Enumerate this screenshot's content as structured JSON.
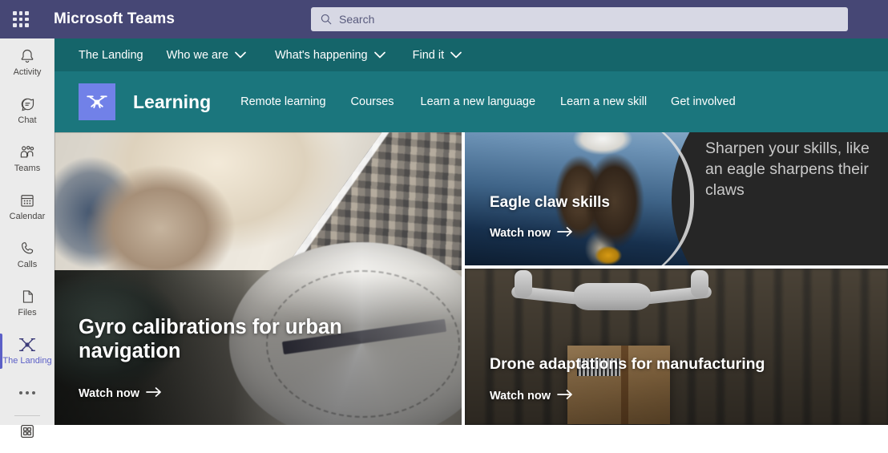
{
  "top_bar": {
    "app_title": "Microsoft Teams",
    "waffle_icon": "grid-apps-icon",
    "search": {
      "icon": "search-icon",
      "placeholder": "Search",
      "value": ""
    }
  },
  "left_rail": {
    "items": [
      {
        "label": "Activity",
        "icon": "bell-icon",
        "active": false
      },
      {
        "label": "Chat",
        "icon": "chat-icon",
        "active": false
      },
      {
        "label": "Teams",
        "icon": "people-icon",
        "active": false
      },
      {
        "label": "Calendar",
        "icon": "calendar-icon",
        "active": false
      },
      {
        "label": "Calls",
        "icon": "phone-icon",
        "active": false
      },
      {
        "label": "Files",
        "icon": "file-icon",
        "active": false
      },
      {
        "label": "The Landing",
        "icon": "drone-icon",
        "active": true
      }
    ],
    "more_icon": "ellipsis-icon",
    "store_icon": "apps-store-icon"
  },
  "site_nav": {
    "items": [
      {
        "label": "The Landing",
        "has_chevron": false
      },
      {
        "label": "Who we are",
        "has_chevron": true
      },
      {
        "label": "What's happening",
        "has_chevron": true
      },
      {
        "label": "Find it",
        "has_chevron": true
      }
    ],
    "chevron_icon": "chevron-down-icon"
  },
  "learning_band": {
    "app_icon": "drone-icon",
    "title": "Learning",
    "links": [
      "Remote learning",
      "Courses",
      "Learn a new language",
      "Learn a new skill",
      "Get involved"
    ]
  },
  "cards": {
    "gyro": {
      "title": "Gyro calibrations for urban navigation",
      "cta": "Watch now",
      "cta_icon": "arrow-right-icon",
      "image_alt": "student-and-aerial-city-and-compass"
    },
    "eagle": {
      "title": "Eagle claw skills",
      "cta": "Watch now",
      "cta_icon": "arrow-right-icon",
      "quote": "Sharpen your skills, like an eagle sharpens their claws",
      "image_alt": "bald-eagle"
    },
    "drone": {
      "title": "Drone adaptations for manufacturing",
      "cta": "Watch now",
      "cta_icon": "arrow-right-icon",
      "image_alt": "drone-carrying-parcel-in-warehouse"
    }
  },
  "colors": {
    "teams_purple": "#464775",
    "nav_teal_dark": "#15656a",
    "band_teal": "#1b767d",
    "accent_indigo": "#5b5fc7",
    "app_tile_blue": "#7181e8",
    "rail_bg": "#ebebeb",
    "search_bg": "#d7d8e4",
    "eagle_panel": "#262626"
  }
}
